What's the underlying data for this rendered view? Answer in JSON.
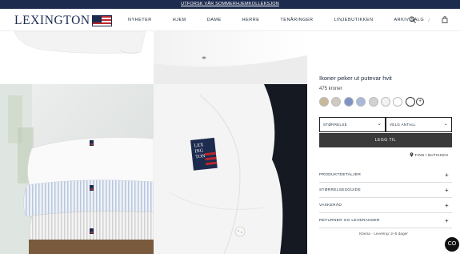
{
  "promo": {
    "text": "UTFORSK VÅR SOMMERHJEMKOLLEKSJON"
  },
  "header": {
    "logo_text": "LEXINGTON",
    "nav": [
      "NYHETER",
      "HJEM",
      "DAME",
      "HERRE",
      "TENÅRINGER",
      "LINJEBUTIKKEN",
      "ARKIV SALG"
    ],
    "icons": {
      "search": "search-icon",
      "divider": "/",
      "bag": "bag-icon"
    }
  },
  "gallery": {
    "label_text": [
      "LEX",
      "ING",
      "TON"
    ],
    "colors": {
      "navy": "#1d2b4f",
      "red": "#b8282e"
    }
  },
  "product": {
    "title": "Ikoner peker ut putevar hvit",
    "price": "475 kroner",
    "swatch_colors": [
      "#c9b89a",
      "#cfc9bf",
      "#7e93c4",
      "#a8b8d8",
      "#d1d1d1",
      "#f2f2f2",
      "#ffffff",
      "#ffffff"
    ],
    "swatch_more": "+",
    "select_size": "STØRRELSE",
    "select_qty": "VELG ANTALL",
    "add_to_cart": "LEGG TIL",
    "find_in_store": "FINN I BUTIKKEN",
    "accordion": [
      "PRODUKTDETALJER",
      "STØRRELSESGUIDE",
      "VASKERÅD",
      "RETURNER OG LEVERANSER"
    ],
    "delivery": "Klarna · Levering: 2–5 dager"
  },
  "chat": {
    "label": "CO"
  }
}
